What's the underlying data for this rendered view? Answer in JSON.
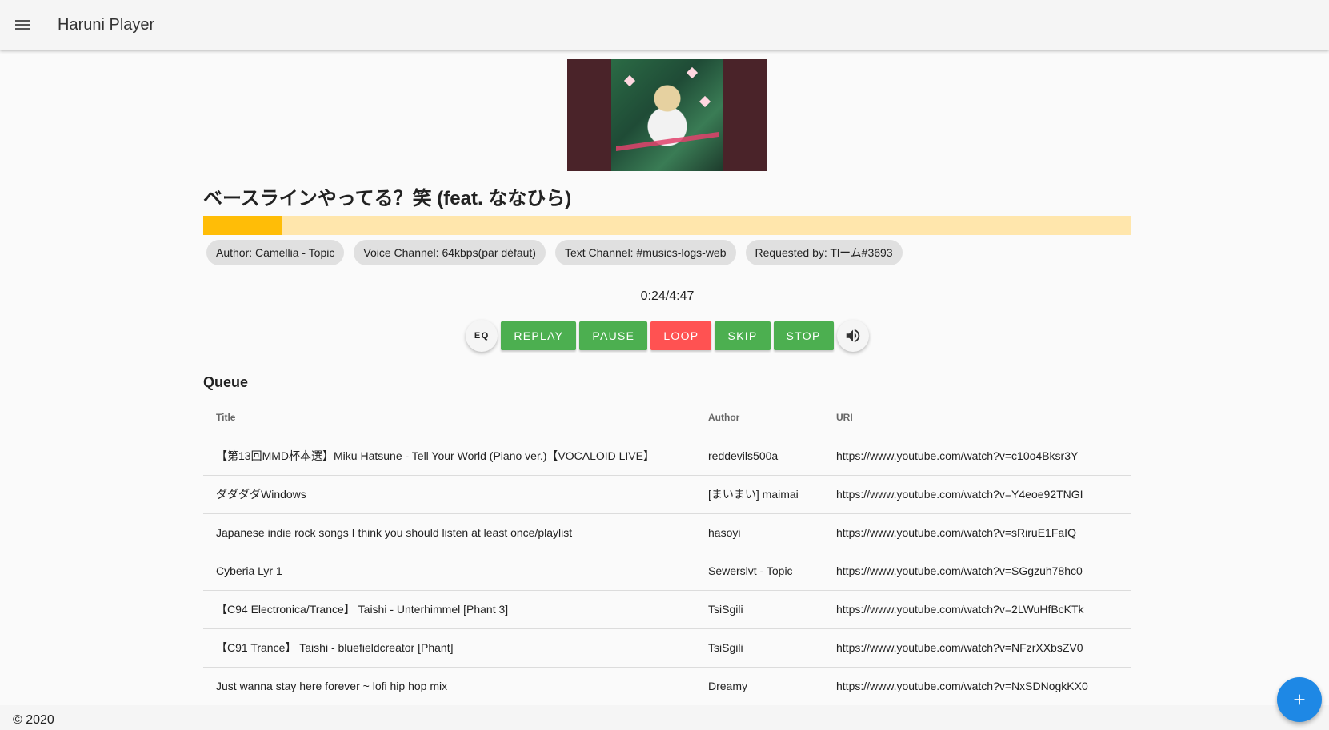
{
  "app": {
    "title": "Haruni Player",
    "menu_icon": "menu-icon"
  },
  "now_playing": {
    "title": "ベースラインやってる？笑 (feat. ななひら)",
    "progress": 0.085,
    "elapsed": "0:24/4:47",
    "colors": {
      "progress_fill": "#ffbd07",
      "progress_track": "#ffe6ac"
    },
    "chips": {
      "author": "Author: Camellia - Topic",
      "voice_channel": "Voice Channel: 64kbps(par défaut)",
      "text_channel": "Text Channel: #musics-logs-web",
      "requested_by": "Requested by: Tlーム#3693"
    }
  },
  "controls": {
    "eq": "EQ",
    "replay": "REPLAY",
    "pause": "PAUSE",
    "loop": "LOOP",
    "skip": "SKIP",
    "stop": "STOP",
    "volume_icon": "volume-up-icon",
    "colors": {
      "green": "#4caf50",
      "red": "#ff5252"
    }
  },
  "queue": {
    "title": "Queue",
    "columns": [
      "Title",
      "Author",
      "URI"
    ],
    "rows": [
      [
        "【第13回MMD杯本選】Miku Hatsune - Tell Your World (Piano ver.)【VOCALOID LIVE】",
        "reddevils500a",
        "https://www.youtube.com/watch?v=c10o4Bksr3Y"
      ],
      [
        "ダダダダWindows",
        "[まいまい] maimai",
        "https://www.youtube.com/watch?v=Y4eoe92TNGI"
      ],
      [
        "Japanese indie rock songs I think you should listen at least once/playlist",
        "hasoyi",
        "https://www.youtube.com/watch?v=sRiruE1FaIQ"
      ],
      [
        "Cyberia Lyr 1",
        "Sewerslvt - Topic",
        "https://www.youtube.com/watch?v=SGgzuh78hc0"
      ],
      [
        "【C94 Electronica/Trance】 Taishi - Unterhimmel [Phant 3]",
        "TsiSgili",
        "https://www.youtube.com/watch?v=2LWuHfBcKTk"
      ],
      [
        "【C91 Trance】 Taishi - bluefieldcreator [Phant]",
        "TsiSgili",
        "https://www.youtube.com/watch?v=NFzrXXbsZV0"
      ],
      [
        "Just wanna stay here forever ~ lofi hip hop mix",
        "Dreamy",
        "https://www.youtube.com/watch?v=NxSDNogkKX0"
      ]
    ]
  },
  "footer": {
    "text": "© 2020"
  },
  "fab": {
    "icon": "plus-icon",
    "color": "#1e88e5"
  }
}
